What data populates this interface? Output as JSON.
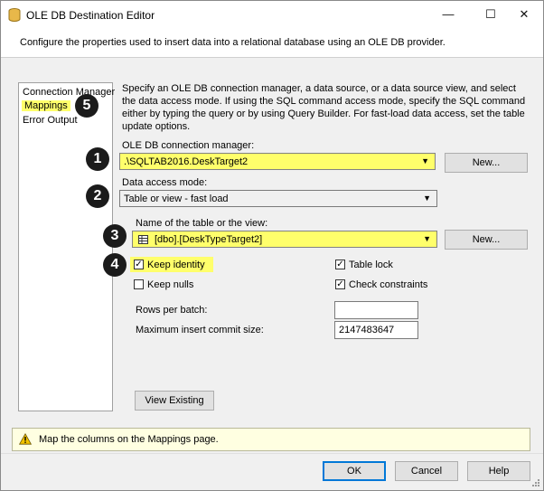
{
  "window": {
    "title": "OLE DB Destination Editor",
    "minimize": "—",
    "maximize": "☐",
    "close": "✕"
  },
  "header": {
    "description": "Configure the properties used to insert data into a relational database using an OLE DB provider."
  },
  "nav": {
    "items": [
      {
        "label": "Connection Manager"
      },
      {
        "label": "Mappings"
      },
      {
        "label": "Error Output"
      }
    ]
  },
  "main": {
    "description": "Specify an OLE DB connection manager, a data source, or a data source view, and select the data access mode. If using the SQL command access mode, specify the SQL command either by typing the query or by using Query Builder. For fast-load data access, set the table update options.",
    "connection_label": "OLE DB connection manager:",
    "connection_value": ".\\SQLTAB2016.DeskTarget2",
    "new_button_1": "New...",
    "access_mode_label": "Data access mode:",
    "access_mode_value": "Table or view - fast load",
    "table_label": "Name of the table or the view:",
    "table_value": "[dbo].[DeskTypeTarget2]",
    "new_button_2": "New...",
    "keep_identity": "Keep identity",
    "table_lock": "Table lock",
    "keep_nulls": "Keep nulls",
    "check_constraints": "Check constraints",
    "rows_per_batch_label": "Rows per batch:",
    "rows_per_batch_value": "",
    "max_commit_label": "Maximum insert commit size:",
    "max_commit_value": "2147483647",
    "view_existing": "View Existing"
  },
  "callouts": [
    "1",
    "2",
    "3",
    "4",
    "5"
  ],
  "status": {
    "message": "Map the columns on the Mappings page."
  },
  "footer": {
    "ok": "OK",
    "cancel": "Cancel",
    "help": "Help"
  },
  "colors": {
    "highlight": "#ffff6b",
    "accent": "#0078d7",
    "badge": "#1b1b1b"
  }
}
